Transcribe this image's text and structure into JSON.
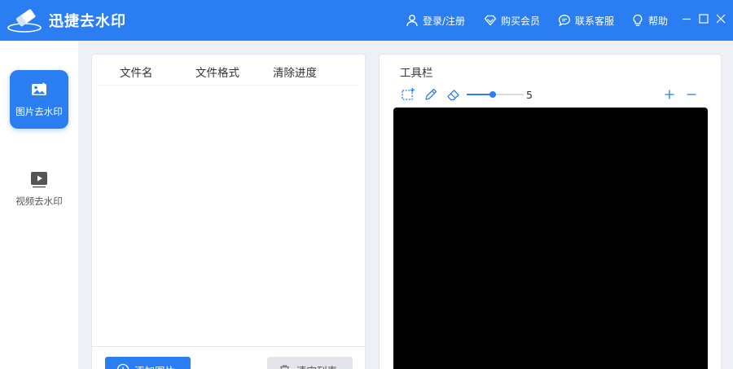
{
  "app": {
    "title": "迅捷去水印",
    "logo_icon": "eraser-logo-icon"
  },
  "titlebar": {
    "login": {
      "label": "登录/注册",
      "icon": "user-icon"
    },
    "vip": {
      "label": "购买会员",
      "icon": "diamond-icon"
    },
    "service": {
      "label": "联系客服",
      "icon": "chat-icon"
    },
    "help": {
      "label": "帮助",
      "icon": "lightbulb-icon"
    },
    "window_controls": [
      "minimize-icon",
      "maximize-icon",
      "close-icon"
    ]
  },
  "sidenav": {
    "items": [
      {
        "label": "图片去水印",
        "icon": "image-icon",
        "active": true
      },
      {
        "label": "视频去水印",
        "icon": "video-play-icon",
        "active": false
      }
    ]
  },
  "file_list": {
    "columns": [
      "文件名",
      "文件格式",
      "清除进度"
    ],
    "rows": [],
    "add_button": "添加图片",
    "clear_button": "清空列表"
  },
  "tools": {
    "title": "工具栏",
    "icons": [
      "rect-select-icon",
      "brush-icon",
      "eraser-icon"
    ],
    "brush_size": "5",
    "brush_size_fraction": 0.45,
    "zoom_in": "zoom-in-icon",
    "zoom_out": "zoom-out-icon"
  },
  "colors": {
    "primary": "#2a7ef2",
    "canvas": "#000000",
    "background": "#eef0f5"
  }
}
